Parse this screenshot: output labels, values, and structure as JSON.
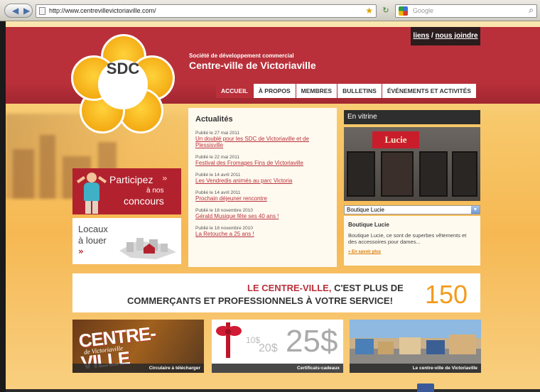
{
  "browser": {
    "url": "http://www.centrevillevictoriaville.com/",
    "search_placeholder": "Google"
  },
  "header": {
    "top_links_1": "liens",
    "top_links_sep": " / ",
    "top_links_2": "nous joindre",
    "logo_text": "SDC",
    "org_small": "Société de développement commercial",
    "org_big": "Centre-ville de Victoriaville"
  },
  "nav": {
    "items": [
      "ACCUEIL",
      "À PROPOS",
      "MEMBRES",
      "BULLETINS",
      "ÉVÉNEMENTS ET ACTIVITÉS"
    ]
  },
  "promos": {
    "contest_line1": "Participez",
    "contest_arrow": "»",
    "contest_line2": "à nos",
    "contest_line3": "concours",
    "rent_line1": "Locaux",
    "rent_line2": "à louer",
    "rent_arrow": "»"
  },
  "news": {
    "title": "Actualités",
    "items": [
      {
        "date": "Publié le 27 mai 2011",
        "title": "Un doublé pour les SDC de Victoriaville et de Plessisville"
      },
      {
        "date": "Publié le 22 mai 2011",
        "title": "Festival des Fromages Fins de Victoriaville"
      },
      {
        "date": "Publié le 14 avril 2011",
        "title": "Les Vendredis animés au parc Victoria"
      },
      {
        "date": "Publié le 14 avril 2011",
        "title": "Prochain déjeuner rencontre"
      },
      {
        "date": "Publié le 18 novembre 2010",
        "title": "Gérald Musique fête ses 40 ans !"
      },
      {
        "date": "Publié le 18 novembre 2010",
        "title": "La Retouche a 25 ans !"
      }
    ]
  },
  "vitrine": {
    "title": "En vitrine",
    "shop_sign": "Lucie",
    "select_value": "Boutique Lucie",
    "desc_title": "Boutique Lucie",
    "desc_text": "Boutique Lucie, ce sont de superbes vêtements et des accessoires pour dames...",
    "more": "» En savoir plus"
  },
  "banner": {
    "line1_red": "LE CENTRE-VILLE,",
    "line1_dark": " C'EST PLUS DE",
    "line2": "COMMERÇANTS ET PROFESSIONNELS À VOTRE SERVICE!",
    "number": "150"
  },
  "tiles": [
    {
      "big": "CENTRE-VILLE",
      "small": "de Victoriaville",
      "caption": "Circulaire à télécharger"
    },
    {
      "s10": "10$",
      "s20": "20$",
      "s25": "25$",
      "caption": "Certificats-cadeaux"
    },
    {
      "caption": "Le centre-ville de Victoriaville"
    }
  ],
  "colors": {
    "brand_red": "#b9303a",
    "accent_orange": "#f39a1c"
  }
}
